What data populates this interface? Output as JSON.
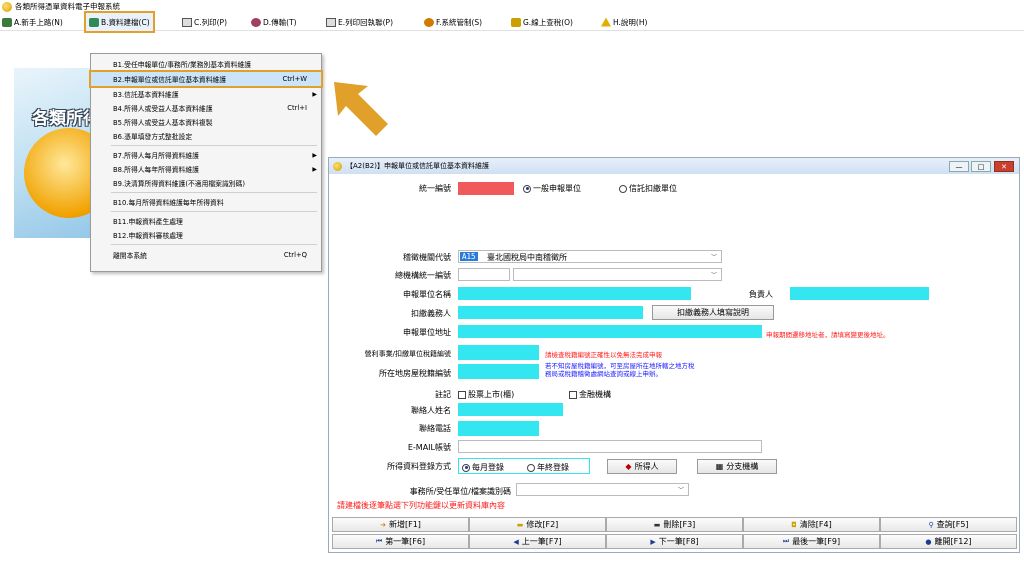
{
  "app": {
    "title": "各類所得憑單資料電子申報系統"
  },
  "menu": [
    {
      "label": "A.新手上路(N)",
      "icon": "new-user-icon"
    },
    {
      "label": "B.資料建檔(C)",
      "icon": "data-entry-icon"
    },
    {
      "label": "C.列印(P)",
      "icon": "printer-icon"
    },
    {
      "label": "D.傳輸(T)",
      "icon": "transfer-icon"
    },
    {
      "label": "E.列印回執聯(P)",
      "icon": "receipt-printer-icon"
    },
    {
      "label": "F.系統管制(S)",
      "icon": "system-control-icon"
    },
    {
      "label": "G.線上查稅(O)",
      "icon": "online-tax-icon"
    },
    {
      "label": "H.說明(H)",
      "icon": "help-icon"
    }
  ],
  "dropdown": {
    "items": [
      {
        "label": "B1.受任申報單位/事務所/業務別基本資料維護",
        "shortcut": "",
        "submenu": false
      },
      {
        "label": "B2.申報單位或信託單位基本資料維護",
        "shortcut": "Ctrl+W",
        "submenu": false
      },
      {
        "label": "B3.信託基本資料維護",
        "shortcut": "",
        "submenu": true
      },
      {
        "label": "B4.所得人或受益人基本資料維護",
        "shortcut": "Ctrl+I",
        "submenu": false
      },
      {
        "label": "B5.所得人或受益人基本資料複製",
        "shortcut": "",
        "submenu": false
      },
      {
        "label": "B6.憑單填發方式整批設定",
        "shortcut": "",
        "submenu": false
      },
      {
        "label": "B7.所得人每月所得資料維護",
        "shortcut": "",
        "submenu": true
      },
      {
        "label": "B8.所得人每年所得資料維護",
        "shortcut": "",
        "submenu": true
      },
      {
        "label": "B9.決清算所得資料維護(不適用檔案識別碼)",
        "shortcut": "",
        "submenu": false
      },
      {
        "label": "B10.每月所得資料維護每年所得資料",
        "shortcut": "",
        "submenu": false
      },
      {
        "label": "B11.申報資料產生處理",
        "shortcut": "",
        "submenu": false
      },
      {
        "label": "B12.申報資料審核處理",
        "shortcut": "",
        "submenu": false
      },
      {
        "label": "離開本系統",
        "shortcut": "Ctrl+Q",
        "submenu": false
      }
    ]
  },
  "banner": {
    "text": "各類所得"
  },
  "colors": {
    "accent_orange": "#e0a02a",
    "redacted_cyan": "#34e6f0",
    "redacted_red": "#f05a5a",
    "warning_red": "#ff1a1a",
    "info_blue": "#1a1aff"
  },
  "dialog": {
    "title": "【A2(B2)】申報單位或信託單位基本資料維護",
    "window_buttons": {
      "minimize": "—",
      "maximize": "□",
      "close": "✕"
    },
    "tax_id_label": "統一編號",
    "unit_type_options": [
      {
        "label": "一般申報單位",
        "selected": true
      },
      {
        "label": "信託扣繳單位",
        "selected": false
      }
    ],
    "office_code_label": "稽徵機關代號",
    "office_code": "A15",
    "office_name": "臺北國稅局中南稽徵所",
    "head_office_label": "總機構統一編號",
    "unit_name_label": "申報單位名稱",
    "owner_label": "負責人",
    "withholder_label": "扣繳義務人",
    "withholder_button": "扣繳義務人填寫說明",
    "address_label": "申報單位地址",
    "address_note": "申報期間遷移地址者，請填寫變更後地址。",
    "business_tax_label": "營利事業/扣繳單位稅籍編號",
    "business_tax_note": "請檢查稅籍編號正確性以免無法完成申報",
    "house_tax_label": "所在地房屋稅籍編號",
    "house_tax_note_1": "若不知房屋稅籍編號，可至房屋所在地所轄之地方稅",
    "house_tax_note_2": "務局或稅籍稽徵處網站查詢或線上申辦。",
    "remark_label": "註記",
    "remark_options": [
      {
        "label": "股票上市(櫃)",
        "checked": false
      },
      {
        "label": "金融機構",
        "checked": false
      }
    ],
    "contact_name_label": "聯絡人姓名",
    "contact_phone_label": "聯絡電話",
    "email_label": "E-MAIL帳號",
    "entry_method_label": "所得資料登錄方式",
    "entry_method_options": [
      {
        "label": "每月登錄",
        "selected": true
      },
      {
        "label": "年終登錄",
        "selected": false
      }
    ],
    "income_person_button": "所得人",
    "branch_button": "分支機構",
    "file_id_label": "事務所/受任單位/檔案識別碼",
    "instruction": "請建檔後逐筆點選下列功能鍵以更新資料庫內容",
    "actions_row1": [
      {
        "label": "新增[F1]",
        "icon": "add-icon",
        "glyph": "➔"
      },
      {
        "label": "修改[F2]",
        "icon": "edit-icon",
        "glyph": "▬"
      },
      {
        "label": "刪除[F3]",
        "icon": "delete-icon",
        "glyph": "▬"
      },
      {
        "label": "清除[F4]",
        "icon": "clear-icon",
        "glyph": "◘"
      },
      {
        "label": "查詢[F5]",
        "icon": "search-icon",
        "glyph": "⚲"
      }
    ],
    "actions_row2": [
      {
        "label": "第一筆[F6]",
        "icon": "first-record-icon",
        "glyph": "⏮"
      },
      {
        "label": "上一筆[F7]",
        "icon": "prev-record-icon",
        "glyph": "◀"
      },
      {
        "label": "下一筆[F8]",
        "icon": "next-record-icon",
        "glyph": "▶"
      },
      {
        "label": "最後一筆[F9]",
        "icon": "last-record-icon",
        "glyph": "⏭"
      },
      {
        "label": "離開[F12]",
        "icon": "exit-icon",
        "glyph": "●"
      }
    ]
  }
}
